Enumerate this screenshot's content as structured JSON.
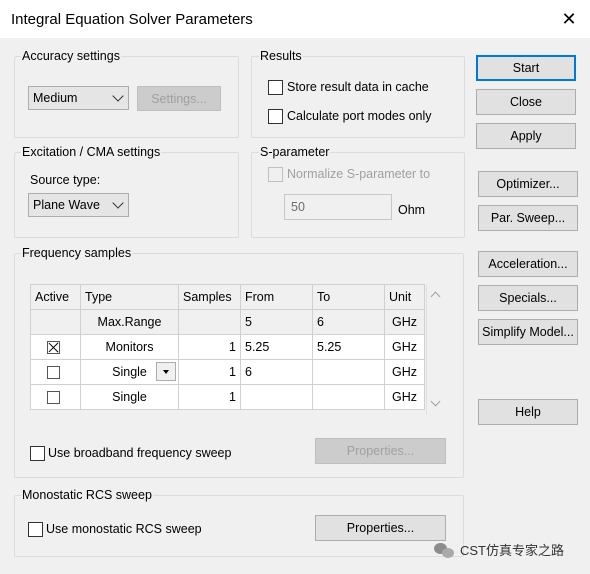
{
  "window": {
    "title": "Integral Equation Solver Parameters",
    "close_symbol": "✕"
  },
  "accuracy": {
    "group_label": "Accuracy settings",
    "selected": "Medium",
    "settings_label": "Settings..."
  },
  "results": {
    "group_label": "Results",
    "store_label": "Store result data in cache",
    "port_modes_label": "Calculate port modes only"
  },
  "excitation": {
    "group_label": "Excitation / CMA settings",
    "source_type_label": "Source type:",
    "source_selected": "Plane Wave"
  },
  "sparam": {
    "group_label": "S-parameter",
    "normalize_label": "Normalize S-parameter to",
    "value": "50",
    "unit": "Ohm"
  },
  "freq": {
    "group_label": "Frequency samples",
    "columns": [
      "Active",
      "Type",
      "Samples",
      "From",
      "To",
      "Unit"
    ],
    "rows": [
      {
        "active": "",
        "type": "Max.Range",
        "samples": "",
        "from": "5",
        "to": "6",
        "unit": "GHz"
      },
      {
        "active": "checked",
        "type": "Monitors",
        "samples": "1",
        "from": "5.25",
        "to": "5.25",
        "unit": "GHz"
      },
      {
        "active": "unchecked",
        "type": "Single",
        "samples": "1",
        "from": "6",
        "to": "",
        "unit": "GHz"
      },
      {
        "active": "unchecked",
        "type": "Single",
        "samples": "1",
        "from": "",
        "to": "",
        "unit": "GHz"
      }
    ],
    "broadband_label": "Use broadband frequency sweep",
    "properties_label": "Properties..."
  },
  "rcs": {
    "group_label": "Monostatic RCS sweep",
    "use_label": "Use monostatic RCS sweep",
    "properties_label": "Properties..."
  },
  "side_buttons": {
    "start": "Start",
    "close": "Close",
    "apply": "Apply",
    "optimizer": "Optimizer...",
    "par_sweep": "Par. Sweep...",
    "acceleration": "Acceleration...",
    "specials": "Specials...",
    "simplify": "Simplify Model...",
    "help": "Help"
  },
  "watermark": {
    "text": "CST仿真专家之路"
  },
  "colors": {
    "accent": "#0078d7",
    "background": "#f0f0f0"
  }
}
